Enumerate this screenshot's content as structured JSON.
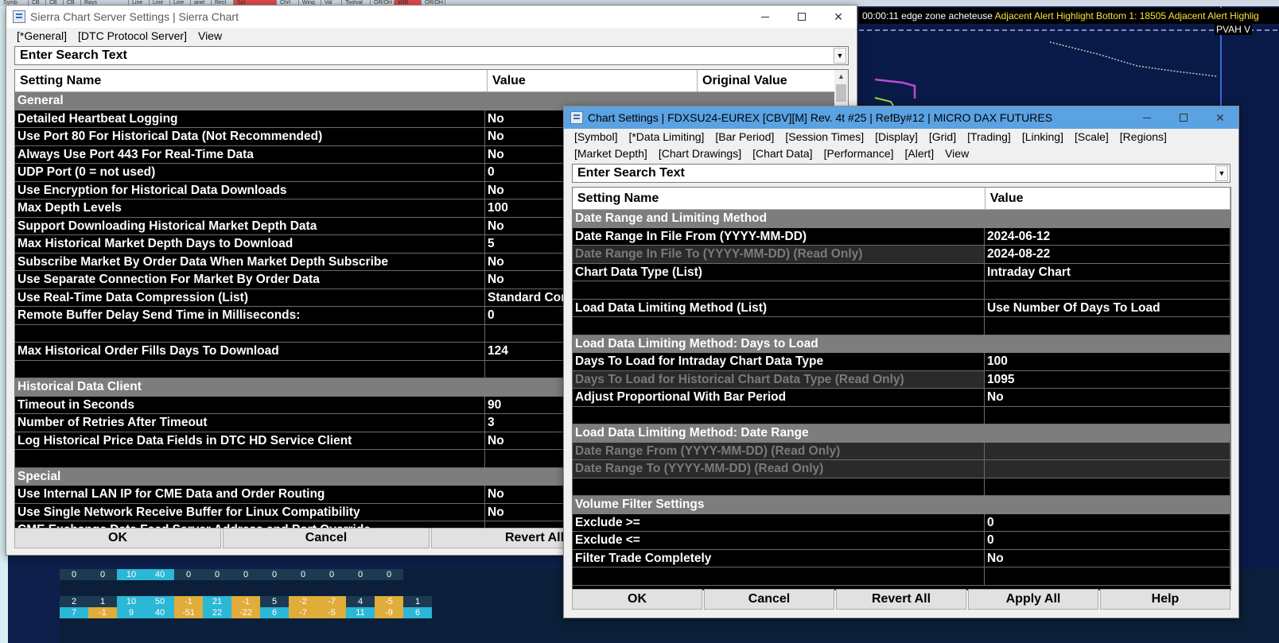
{
  "bg": {
    "toolbar_buttons": [
      "Symb",
      "CB",
      "CB",
      "CB",
      "Rays",
      "Line",
      "Line",
      "Line",
      "anel",
      "Rect",
      "Set",
      "Chrt",
      "Wing",
      "Val",
      "Toolval",
      "OR/OH",
      "WIR",
      "OR/OH"
    ],
    "alert_text": "00:00:11 edge zone acheteuse",
    "alert_yellow": "Adjacent Alert Highlight Bottom 1: 18505  Adjacent Alert Highlig",
    "pvah_label": "PVAH V",
    "bottom_rows": [
      [
        "0",
        "0",
        "10",
        "40",
        "0",
        "0",
        "0",
        "0",
        "0",
        "0",
        "0",
        "0"
      ],
      [
        "2",
        "1",
        "10",
        "50",
        "-1",
        "21",
        "-1",
        "5",
        "-2",
        "-7",
        "4",
        "-5",
        "1"
      ],
      [
        "7",
        "-1",
        "9",
        "40",
        "-51",
        "22",
        "-22",
        "6",
        "-7",
        "-5",
        "11",
        "-9",
        "6"
      ]
    ]
  },
  "server_window": {
    "title": "Sierra Chart Server Settings | Sierra Chart",
    "menu": [
      "[*General]",
      "[DTC Protocol Server]",
      "View"
    ],
    "search_text": "Enter Search Text",
    "columns": [
      "Setting Name",
      "Value",
      "Original Value"
    ],
    "rows": [
      {
        "type": "section",
        "name": "General"
      },
      {
        "type": "row",
        "name": "Detailed Heartbeat Logging",
        "value": "No"
      },
      {
        "type": "row",
        "name": "Use Port 80 For Historical Data (Not Recommended)",
        "value": "No"
      },
      {
        "type": "row",
        "name": "Always Use Port 443 For Real-Time Data",
        "value": "No"
      },
      {
        "type": "row",
        "name": "UDP Port (0 = not used)",
        "value": "0"
      },
      {
        "type": "row",
        "name": "Use Encryption for Historical Data Downloads",
        "value": "No"
      },
      {
        "type": "row",
        "name": "Max Depth Levels",
        "value": "100"
      },
      {
        "type": "row",
        "name": "Support Downloading Historical Market Depth Data",
        "value": "No"
      },
      {
        "type": "row",
        "name": "Max Historical Market Depth Days to Download",
        "value": "5"
      },
      {
        "type": "row",
        "name": "Subscribe Market By Order Data When Market Depth Subscribe",
        "value": "No"
      },
      {
        "type": "row",
        "name": "Use Separate Connection For Market By Order Data",
        "value": "No"
      },
      {
        "type": "row",
        "name": "Use Real-Time Data Compression (List)",
        "value": "Standard Con"
      },
      {
        "type": "row",
        "name": "Remote Buffer Delay Send Time in Milliseconds:",
        "value": "0"
      },
      {
        "type": "blank"
      },
      {
        "type": "row",
        "name": "Max Historical Order Fills Days To Download",
        "value": "124"
      },
      {
        "type": "blank"
      },
      {
        "type": "section",
        "name": "Historical Data Client"
      },
      {
        "type": "row",
        "name": "Timeout in Seconds",
        "value": "90"
      },
      {
        "type": "row",
        "name": "Number of Retries After Timeout",
        "value": "3"
      },
      {
        "type": "row",
        "name": "Log Historical Price Data Fields in DTC HD Service Client",
        "value": "No"
      },
      {
        "type": "blank"
      },
      {
        "type": "section",
        "name": "Special"
      },
      {
        "type": "row",
        "name": "Use Internal LAN IP for CME Data and Order Routing",
        "value": "No"
      },
      {
        "type": "row",
        "name": "Use Single Network Receive Buffer for Linux Compatibility",
        "value": "No"
      },
      {
        "type": "row",
        "name": "CME Exchange Data Feed Server Address and Port Override",
        "value": ""
      }
    ],
    "buttons": [
      "OK",
      "Cancel",
      "Revert All"
    ]
  },
  "chart_window": {
    "title": "Chart Settings | FDXSU24-EUREX [CBV][M]  Rev. 4t #25 | RefBy#12 | MICRO DAX FUTURES",
    "menu": [
      "[Symbol]",
      "[*Data Limiting]",
      "[Bar Period]",
      "[Session Times]",
      "[Display]",
      "[Grid]",
      "[Trading]",
      "[Linking]",
      "[Scale]",
      "[Regions]",
      "[Market Depth]",
      "[Chart Drawings]",
      "[Chart Data]",
      "[Performance]",
      "[Alert]",
      "View"
    ],
    "search_text": "Enter Search Text",
    "columns": [
      "Setting Name",
      "Value"
    ],
    "rows": [
      {
        "type": "section",
        "name": "Date Range and Limiting Method"
      },
      {
        "type": "row",
        "name": "Date Range In File From (YYYY-MM-DD)",
        "value": "2024-06-12"
      },
      {
        "type": "readonly",
        "name": "Date Range In File To (YYYY-MM-DD) (Read Only)",
        "value": "2024-08-22"
      },
      {
        "type": "row",
        "name": "Chart Data Type (List)",
        "value": "Intraday Chart"
      },
      {
        "type": "blank"
      },
      {
        "type": "row",
        "name": "Load Data Limiting Method (List)",
        "value": "Use Number Of Days To Load"
      },
      {
        "type": "blank"
      },
      {
        "type": "section",
        "name": "Load Data Limiting Method: Days to Load"
      },
      {
        "type": "row",
        "name": "Days To Load for Intraday Chart Data Type",
        "value": "100"
      },
      {
        "type": "readonly",
        "name": "Days To Load for Historical Chart Data Type (Read Only)",
        "value": "1095"
      },
      {
        "type": "row",
        "name": "Adjust Proportional With Bar Period",
        "value": "No"
      },
      {
        "type": "blank"
      },
      {
        "type": "section",
        "name": "Load Data Limiting Method: Date Range"
      },
      {
        "type": "readonly-empty",
        "name": "Date Range From (YYYY-MM-DD) (Read Only)",
        "value": ""
      },
      {
        "type": "readonly-empty",
        "name": "Date Range To (YYYY-MM-DD) (Read Only)",
        "value": ""
      },
      {
        "type": "blank"
      },
      {
        "type": "section",
        "name": "Volume Filter Settings"
      },
      {
        "type": "row",
        "name": "Exclude >=",
        "value": "0"
      },
      {
        "type": "row",
        "name": "Exclude <=",
        "value": "0"
      },
      {
        "type": "row",
        "name": "Filter Trade Completely",
        "value": "No"
      },
      {
        "type": "blank"
      }
    ],
    "buttons": [
      "OK",
      "Cancel",
      "Revert All",
      "Apply All",
      "Help"
    ]
  }
}
